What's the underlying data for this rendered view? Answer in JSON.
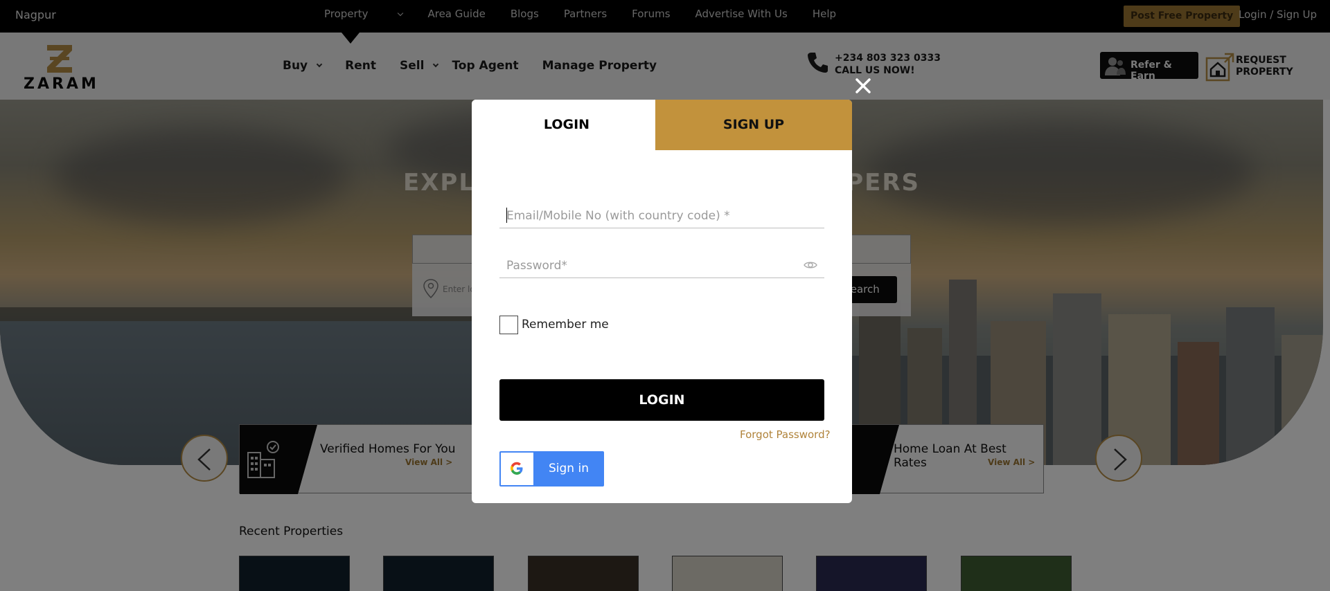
{
  "topbar": {
    "city": "Nagpur",
    "nav": [
      "Property",
      "Area Guide",
      "Blogs",
      "Partners",
      "Forums",
      "Advertise With Us",
      "Help"
    ],
    "post_label": "Post Free Property",
    "login_label": "Login / Sign Up"
  },
  "header": {
    "logo_text": "ZARAM",
    "nav": {
      "buy": "Buy",
      "rent": "Rent",
      "sell": "Sell",
      "top_agent": "Top Agent",
      "manage": "Manage Property"
    },
    "phone_number": "+234 803 323 0333",
    "phone_cta": "CALL US NOW!",
    "refer_label": "Refer & Earn",
    "request_line1": "REQUEST",
    "request_line2": "PROPERTY"
  },
  "hero": {
    "heading": "EXPLORE PROPERTY & DEVELOPERS",
    "search_placeholder": "Enter location",
    "search_label": "Search"
  },
  "features": {
    "left_title": "Verified Homes For You",
    "left_link": "View All >",
    "right_title": "Home Loan At Best Rates",
    "right_link": "View All >"
  },
  "recent": {
    "title": "Recent Properties"
  },
  "modal": {
    "tab_login": "LOGIN",
    "tab_signup": "SIGN UP",
    "email_placeholder": "Email/Mobile No (with country code) *",
    "password_placeholder": "Password*",
    "remember_label": "Remember me",
    "login_button": "LOGIN",
    "forgot_label": "Forgot Password?",
    "google_label": "Sign in"
  },
  "colors": {
    "accent": "#c2923c",
    "dark": "#000000",
    "google_blue": "#4285f4"
  }
}
